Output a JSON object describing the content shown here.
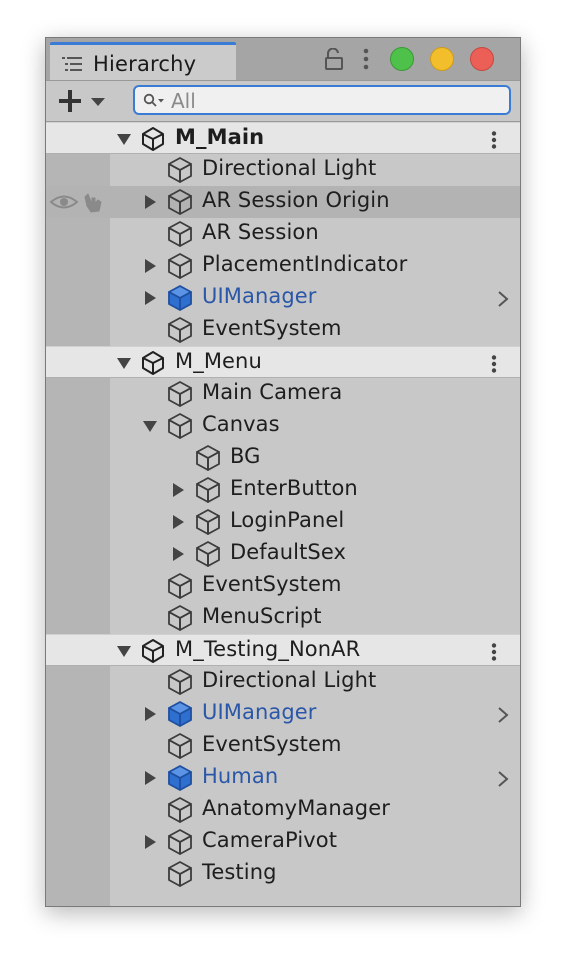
{
  "window": {
    "tab_label": "Hierarchy",
    "icons": {
      "tab": "list-icon",
      "lock": "lock-icon",
      "menu": "kebab-icon"
    },
    "traffic_lights": [
      "#4ec14a",
      "#f3be2b",
      "#ec5f57"
    ]
  },
  "toolbar": {
    "add_icon": "plus-icon",
    "dropdown_icon": "caret-down-icon",
    "search": {
      "placeholder": "All",
      "value": ""
    }
  },
  "colors": {
    "prefab_text": "#2a57a8",
    "prefab_cube": "#2e6fd0",
    "scene_header_bg": "#e6e6e6",
    "panel_bg": "#c8c8c8"
  },
  "rows": [
    {
      "type": "scene",
      "label": "M_Main",
      "bold": true,
      "expanded": true
    },
    {
      "type": "object",
      "label": "Directional Light",
      "depth": 1
    },
    {
      "type": "object",
      "label": "AR Session Origin",
      "depth": 1,
      "arrow": "collapsed",
      "hover": true,
      "gutter_icons": [
        "eye-icon",
        "hand-icon"
      ]
    },
    {
      "type": "object",
      "label": "AR Session",
      "depth": 1
    },
    {
      "type": "object",
      "label": "PlacementIndicator",
      "depth": 1,
      "arrow": "collapsed"
    },
    {
      "type": "prefab",
      "label": "UIManager",
      "depth": 1,
      "arrow": "collapsed",
      "chevron": true
    },
    {
      "type": "object",
      "label": "EventSystem",
      "depth": 1
    },
    {
      "type": "scene",
      "label": "M_Menu",
      "bold": false,
      "expanded": true
    },
    {
      "type": "object",
      "label": "Main Camera",
      "depth": 1
    },
    {
      "type": "object",
      "label": "Canvas",
      "depth": 1,
      "arrow": "expanded"
    },
    {
      "type": "object",
      "label": "BG",
      "depth": 2
    },
    {
      "type": "object",
      "label": "EnterButton",
      "depth": 2,
      "arrow": "collapsed"
    },
    {
      "type": "object",
      "label": "LoginPanel",
      "depth": 2,
      "arrow": "collapsed"
    },
    {
      "type": "object",
      "label": "DefaultSex",
      "depth": 2,
      "arrow": "collapsed"
    },
    {
      "type": "object",
      "label": "EventSystem",
      "depth": 1
    },
    {
      "type": "object",
      "label": "MenuScript",
      "depth": 1
    },
    {
      "type": "scene",
      "label": "M_Testing_NonAR",
      "bold": false,
      "expanded": true
    },
    {
      "type": "object",
      "label": "Directional Light",
      "depth": 1
    },
    {
      "type": "prefab",
      "label": "UIManager",
      "depth": 1,
      "arrow": "collapsed",
      "chevron": true
    },
    {
      "type": "object",
      "label": "EventSystem",
      "depth": 1
    },
    {
      "type": "prefab",
      "label": "Human",
      "depth": 1,
      "arrow": "collapsed",
      "chevron": true
    },
    {
      "type": "object",
      "label": "AnatomyManager",
      "depth": 1
    },
    {
      "type": "object",
      "label": "CameraPivot",
      "depth": 1,
      "arrow": "collapsed"
    },
    {
      "type": "object",
      "label": "Testing",
      "depth": 1
    }
  ]
}
